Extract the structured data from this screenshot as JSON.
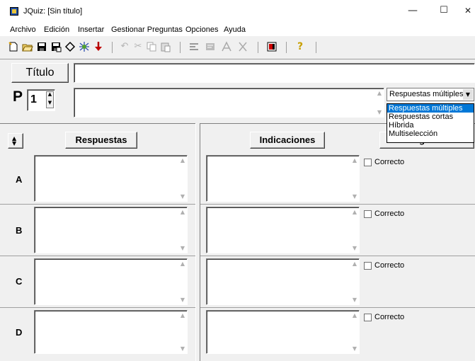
{
  "window": {
    "title": "JQuiz: [Sin título]",
    "minimize": "—",
    "maximize": "☐",
    "close": "✕"
  },
  "menu": [
    "Archivo",
    "Edición",
    "Insertar",
    "Gestionar Preguntas",
    "Opciones",
    "Ayuda"
  ],
  "toolbar": {
    "icons": [
      "new-file-icon",
      "open-folder-icon",
      "save-icon",
      "save-as-icon",
      "export-icon",
      "web-icon",
      "download-icon",
      "undo-icon",
      "cut-icon",
      "copy-icon",
      "paste-icon",
      "tool-a-icon",
      "tool-b-icon",
      "tool-c-icon",
      "tool-d-icon",
      "flag-icon",
      "help-icon"
    ],
    "help_label": "?"
  },
  "question": {
    "title_label": "Título",
    "title_value": "",
    "p_label": "P",
    "number": "1",
    "text": ""
  },
  "type_select": {
    "selected": "Respuestas múltiples",
    "options": [
      "Respuestas múltiples",
      "Respuestas cortas",
      "Híbrida",
      "Multiselección"
    ]
  },
  "headers": {
    "answers": "Respuestas",
    "feedback": "Indicaciones",
    "config": "Configuración"
  },
  "rows": [
    {
      "letter": "A",
      "correct_label": "Correcto"
    },
    {
      "letter": "B",
      "correct_label": "Correcto"
    },
    {
      "letter": "C",
      "correct_label": "Correcto"
    },
    {
      "letter": "D",
      "correct_label": "Correcto"
    }
  ]
}
